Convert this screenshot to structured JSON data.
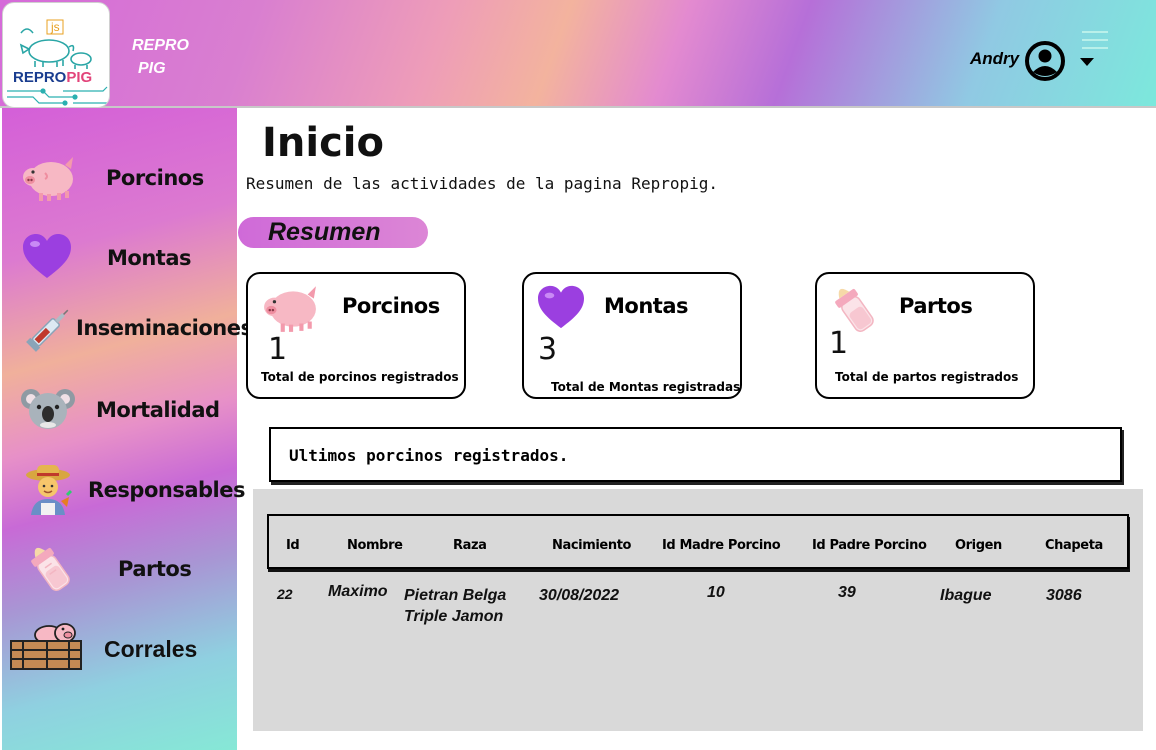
{
  "header": {
    "logo_text_a": "REPRO",
    "logo_text_b": "PIG",
    "logo_badge": "js",
    "brand_line1": "REPRO",
    "brand_line2": "PIG",
    "user_name": "Andry"
  },
  "sidebar": {
    "items": [
      {
        "label": "Porcinos",
        "icon": "pig-face-icon"
      },
      {
        "label": "Montas",
        "icon": "purple-heart-icon"
      },
      {
        "label": "Inseminaciones",
        "icon": "syringe-icon"
      },
      {
        "label": "Mortalidad",
        "icon": "koala-icon"
      },
      {
        "label": "Responsables",
        "icon": "farmer-icon"
      },
      {
        "label": "Partos",
        "icon": "baby-bottle-icon"
      },
      {
        "label": "Corrales",
        "icon": "pig-pen-icon"
      }
    ]
  },
  "main": {
    "title": "Inicio",
    "subtitle": "Resumen de las actividades de la pagina Repropig.",
    "section_label": "Resumen",
    "cards": [
      {
        "title": "Porcinos",
        "count": "1",
        "desc": "Total de porcinos registrados",
        "icon": "pig-face-icon"
      },
      {
        "title": "Montas",
        "count": "3",
        "desc": "Total de Montas registradas",
        "icon": "purple-heart-icon"
      },
      {
        "title": "Partos",
        "count": "1",
        "desc": "Total de partos registrados",
        "icon": "baby-bottle-icon"
      }
    ],
    "recent_label": "Ultimos porcinos registrados.",
    "table": {
      "columns": [
        "Id",
        "Nombre",
        "Raza",
        "Nacimiento",
        "Id Madre Porcino",
        "Id Padre Porcino",
        "Origen",
        "Chapeta"
      ],
      "rows": [
        {
          "id": "22",
          "nombre": "Maximo",
          "raza_1": "Pietran Belga",
          "raza_2": "Triple Jamon",
          "nacimiento": "30/08/2022",
          "madre": "10",
          "padre": "39",
          "origen": "Ibague",
          "chapeta": "3086"
        }
      ]
    }
  },
  "colors": {
    "accent_pink": "#d56ad9",
    "accent_teal": "#7ce8dc",
    "panel_gray": "#d9d9d9"
  }
}
